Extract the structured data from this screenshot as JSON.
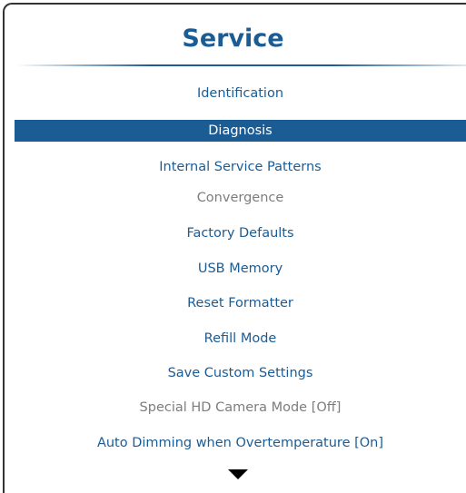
{
  "menu": {
    "title": "Service",
    "selected_index": 1,
    "items": [
      {
        "label": "Identification",
        "state": "enabled"
      },
      {
        "label": "Diagnosis",
        "state": "selected"
      },
      {
        "label": "Internal Service Patterns",
        "state": "enabled"
      },
      {
        "label": "Convergence",
        "state": "disabled"
      },
      {
        "label": "Factory Defaults",
        "state": "enabled"
      },
      {
        "label": "USB Memory",
        "state": "enabled"
      },
      {
        "label": "Reset Formatter",
        "state": "enabled"
      },
      {
        "label": "Refill Mode",
        "state": "enabled"
      },
      {
        "label": "Save Custom Settings",
        "state": "enabled"
      },
      {
        "label": "Special HD Camera Mode [Off]",
        "state": "disabled"
      },
      {
        "label": "Auto Dimming when Overtemperature [On]",
        "state": "enabled"
      }
    ],
    "scroll_indicator_icon": "triangle-down-icon"
  },
  "colors": {
    "accent": "#1b5c95",
    "selected_text": "#ffffff",
    "disabled_text": "#7d7d7d",
    "background": "#ffffff",
    "frame": "#333333"
  }
}
